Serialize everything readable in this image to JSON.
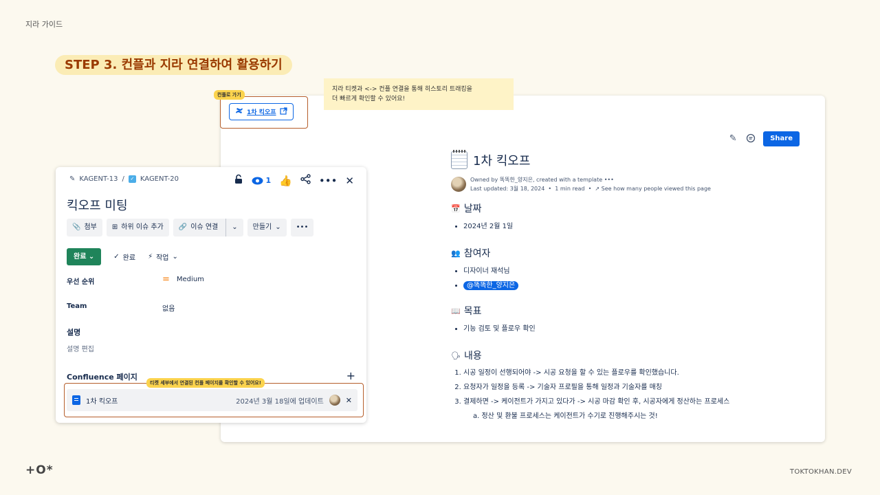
{
  "guide_label": "지라 가이드",
  "step_title": "STEP 3. 컨플과 지라 연결하여 활용하기",
  "footer": {
    "brand": "+O*",
    "url": "TOKTOKHAN.DEV"
  },
  "annotations": {
    "goto_tag": "컨플로 가기",
    "goto_button": "1차 킥오프",
    "note_line1": "지라 티켓과 <-> 컨플 연결을 통해 히스토리 트래킹을",
    "note_line2": "더 빠르게 확인할 수 있어요!",
    "detail_tag": "티켓 세부에서 연결된 컨플 페이지를 확인할 수 있어요!"
  },
  "confluence": {
    "share_label": "Share",
    "title": "1차 킥오프",
    "owned_by": "Owned by 똑똑한_양지은, created with a template",
    "last_updated": "Last updated: 3월 18, 2024",
    "read_time": "1 min read",
    "viewers_link": "See how many people viewed this page",
    "sections": [
      {
        "title": "날짜",
        "emoji": "📅",
        "items": [
          "2024년 2월 1일"
        ]
      },
      {
        "title": "참여자",
        "emoji": "👥",
        "items": [
          "디자이너 재석님"
        ],
        "mention": "@똑똑한_양지은"
      },
      {
        "title": "목표",
        "emoji": "📖",
        "items": [
          "기능 검토 및 플로우 확인"
        ]
      },
      {
        "title": "내용",
        "emoji": "🗣",
        "items": [
          "시공 일정이 선행되어야 -> 시공 요청을 할 수 있는 플로우를 확인했습니다.",
          "요청자가 일정을 등록 -> 기술자 프로필을 통해 일정과 기술자를 매칭",
          "결제하면 -> 케이전트가 가지고 있다가 -> 시공 마감 확인 후, 시공자에게 정산하는 프로세스"
        ],
        "subitem": "a. 정산 및 환불 프로세스는 케이전트가 수기로 진행해주시는 것!"
      }
    ]
  },
  "jira": {
    "parent_key": "KAGENT-13",
    "issue_key": "KAGENT-20",
    "watch_count": "1",
    "title": "킥오프 미팅",
    "actions": {
      "attach": "첨부",
      "child": "하위 이슈 추가",
      "link": "이슈 연결",
      "create": "만들기"
    },
    "status": "완료",
    "resolution": "완료",
    "type": "작업",
    "fields": {
      "priority_label": "우선 순위",
      "priority_value": "Medium",
      "team_label": "Team",
      "team_value": "없음"
    },
    "description_label": "설명",
    "description_edit": "설명 편집",
    "confluence_label": "Confluence 페이지",
    "linked_page": {
      "title": "1차 킥오프",
      "updated": "2024년 3월 18일에 업데이트"
    }
  }
}
